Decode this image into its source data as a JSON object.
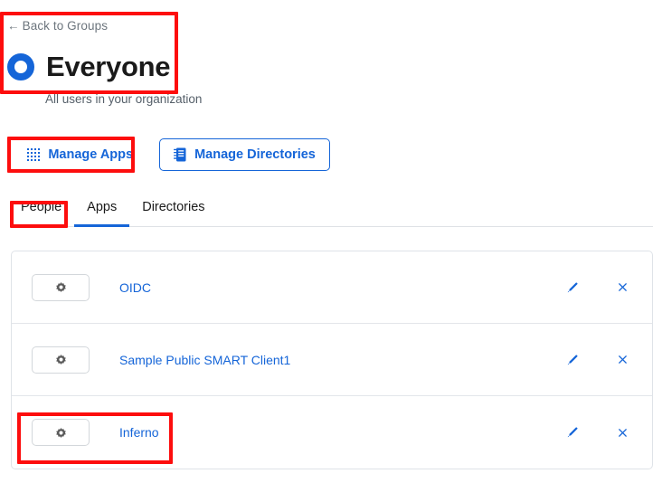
{
  "header": {
    "back_label": "Back to Groups",
    "back_arrow": "←",
    "group_name": "Everyone",
    "group_description": "All users in your organization"
  },
  "actions": {
    "manage_apps_label": "Manage Apps",
    "manage_apps_icon": "grid-icon",
    "manage_directories_label": "Manage Directories",
    "manage_directories_icon": "address-book-icon"
  },
  "tabs": [
    {
      "label": "People",
      "active": false
    },
    {
      "label": "Apps",
      "active": true
    },
    {
      "label": "Directories",
      "active": false
    }
  ],
  "app_list": [
    {
      "settings_icon": "gear-icon",
      "name": "OIDC",
      "edit_icon": "pencil-icon",
      "delete_icon": "close-x-icon"
    },
    {
      "settings_icon": "gear-icon",
      "name": "Sample Public SMART Client1",
      "edit_icon": "pencil-icon",
      "delete_icon": "close-x-icon"
    },
    {
      "settings_icon": "gear-icon",
      "name": "Inferno",
      "edit_icon": "pencil-icon",
      "delete_icon": "close-x-icon"
    }
  ],
  "colors": {
    "accent_blue": "#1565d8",
    "annotation_red": "#fd0d0d",
    "text_dark": "#1a1a1a",
    "text_muted": "#6c757d",
    "border_gray": "#dfe3e8"
  },
  "annotations": [
    {
      "target": "header-block"
    },
    {
      "target": "manage-apps-button"
    },
    {
      "target": "tab-people"
    },
    {
      "target": "inferno-row-left"
    }
  ]
}
